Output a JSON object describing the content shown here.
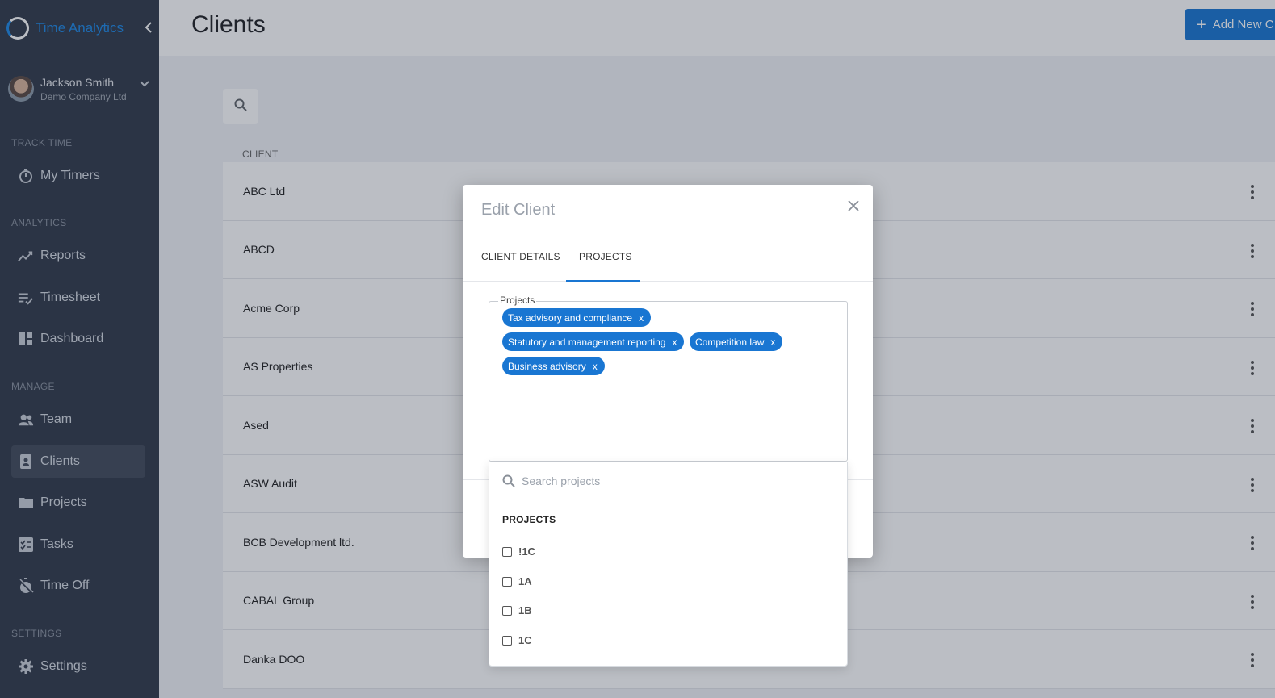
{
  "app": {
    "name": "Time Analytics",
    "collapse_icon": "chevron-left-icon"
  },
  "user": {
    "name": "Jackson Smith",
    "company": "Demo Company Ltd"
  },
  "sidebar": {
    "sections": [
      {
        "label": "TRACK TIME",
        "items": [
          {
            "label": "My Timers",
            "icon": "timer-icon"
          }
        ]
      },
      {
        "label": "ANALYTICS",
        "items": [
          {
            "label": "Reports",
            "icon": "trending-icon"
          },
          {
            "label": "Timesheet",
            "icon": "checklist-icon"
          },
          {
            "label": "Dashboard",
            "icon": "dashboard-icon"
          }
        ]
      },
      {
        "label": "MANAGE",
        "items": [
          {
            "label": "Team",
            "icon": "people-icon"
          },
          {
            "label": "Clients",
            "icon": "contact-icon",
            "active": true
          },
          {
            "label": "Projects",
            "icon": "folder-icon"
          },
          {
            "label": "Tasks",
            "icon": "tasks-icon"
          },
          {
            "label": "Time Off",
            "icon": "timer-off-icon"
          }
        ]
      },
      {
        "label": "SETTINGS",
        "items": [
          {
            "label": "Settings",
            "icon": "gear-icon"
          }
        ]
      }
    ]
  },
  "header": {
    "title": "Clients",
    "add_button": "Add New C"
  },
  "table": {
    "column": "CLIENT",
    "rows": [
      "ABC Ltd",
      "ABCD",
      "Acme Corp",
      "AS Properties",
      "Ased",
      "ASW Audit",
      "BCB Development ltd.",
      "CABAL Group",
      "Danka DOO"
    ]
  },
  "modal": {
    "title": "Edit Client",
    "tabs": [
      "CLIENT DETAILS",
      "PROJECTS"
    ],
    "active_tab": "PROJECTS",
    "field_label": "Projects",
    "selected_projects": [
      "Tax advisory and compliance",
      "Statutory and management reporting",
      "Competition law",
      "Business advisory"
    ],
    "chip_remove": "x",
    "dropdown": {
      "search_placeholder": "Search projects",
      "group_label": "PROJECTS",
      "options": [
        "!1C",
        "1A",
        "1B",
        "1C"
      ]
    }
  },
  "colors": {
    "accent": "#1976d2",
    "sidebar": "#323a49"
  }
}
